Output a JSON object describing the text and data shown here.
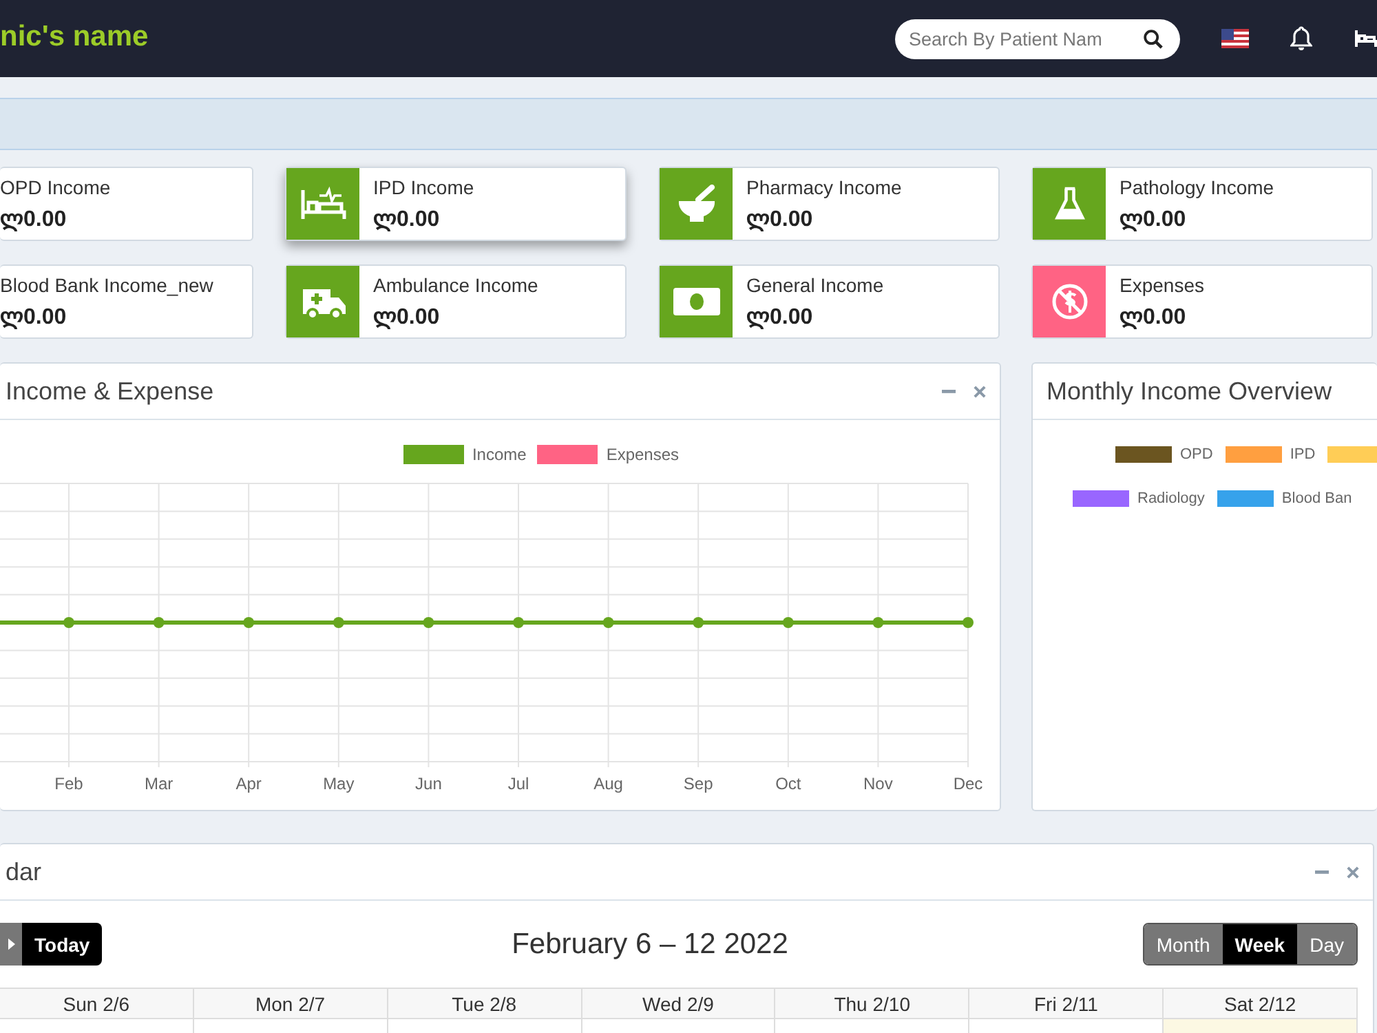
{
  "header": {
    "brand": "nic's name",
    "search": {
      "placeholder": "Search By Patient Nam"
    }
  },
  "cards": [
    {
      "title": "OPD Income",
      "value": "ლ0.00",
      "hovered": false
    },
    {
      "title": "IPD Income",
      "value": "ლ0.00",
      "hovered": true,
      "color": "#66a61e"
    },
    {
      "title": "Pharmacy Income",
      "value": "ლ0.00",
      "hovered": false,
      "color": "#66a61e"
    },
    {
      "title": "Pathology Income",
      "value": "ლ0.00",
      "hovered": false,
      "color": "#66a61e"
    },
    {
      "title": "Blood Bank Income_new",
      "value": "ლ0.00",
      "hovered": false
    },
    {
      "title": "Ambulance Income",
      "value": "ლ0.00",
      "hovered": false,
      "color": "#66a61e"
    },
    {
      "title": "General Income",
      "value": "ლ0.00",
      "hovered": false,
      "color": "#66a61e"
    },
    {
      "title": "Expenses",
      "value": "ლ0.00",
      "hovered": false,
      "color": "#ff6384"
    }
  ],
  "income_panel": {
    "title": "Income & Expense",
    "legend": [
      {
        "label": "Income",
        "color": "#66a61e"
      },
      {
        "label": "Expenses",
        "color": "#ff6384"
      }
    ],
    "months": [
      "Feb",
      "Mar",
      "Apr",
      "May",
      "Jun",
      "Jul",
      "Aug",
      "Sep",
      "Oct",
      "Nov",
      "Dec"
    ]
  },
  "overview_panel": {
    "title": "Monthly Income Overview",
    "legend": [
      {
        "label": "OPD",
        "color": "#6b5520"
      },
      {
        "label": "IPD",
        "color": "#ff9f40"
      },
      {
        "color": "#ffcd56"
      },
      {
        "label": "Radiology",
        "color": "#9966ff"
      },
      {
        "label": "Blood Ban",
        "color": "#36a2eb"
      }
    ]
  },
  "calendar": {
    "title": "dar",
    "today": "Today",
    "range": "February 6 – 12 2022",
    "views": [
      {
        "label": "Month",
        "selected": false
      },
      {
        "label": "Week",
        "selected": true
      },
      {
        "label": "Day",
        "selected": false
      }
    ],
    "days": [
      {
        "label": "Sun 2/6",
        "today": false
      },
      {
        "label": "Mon 2/7",
        "today": false
      },
      {
        "label": "Tue 2/8",
        "today": false
      },
      {
        "label": "Wed 2/9",
        "today": false
      },
      {
        "label": "Thu 2/10",
        "today": false
      },
      {
        "label": "Fri 2/11",
        "today": false
      },
      {
        "label": "Sat 2/12",
        "today": true
      }
    ]
  }
}
